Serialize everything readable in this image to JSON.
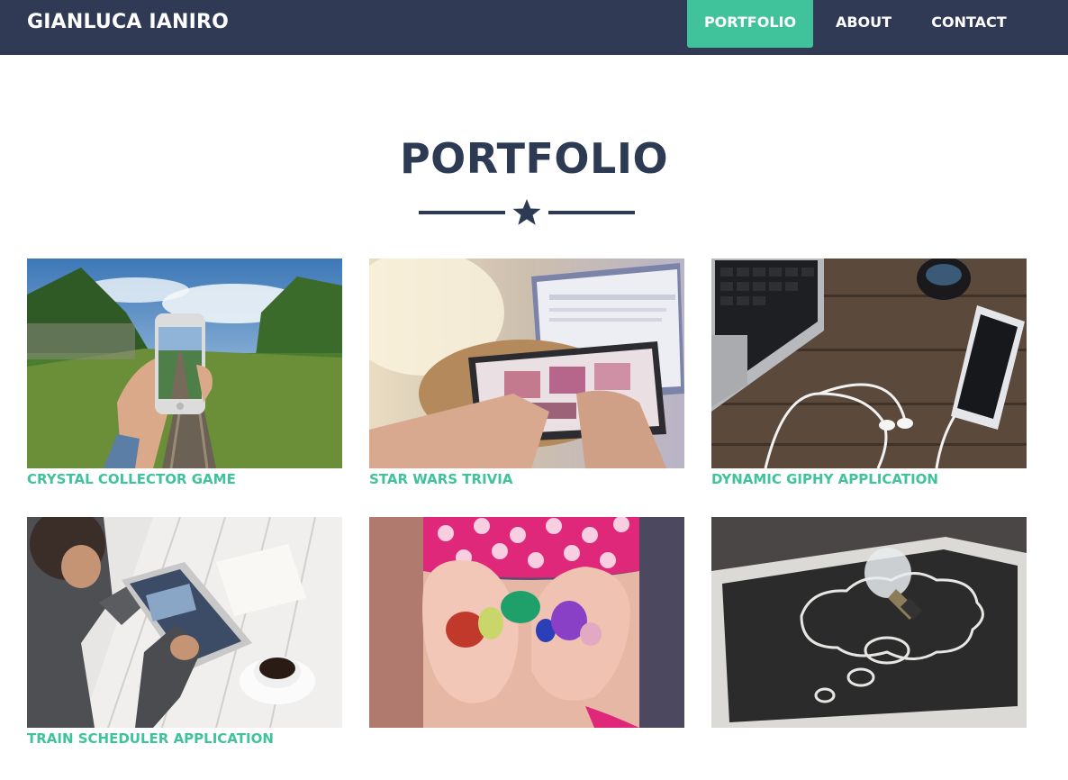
{
  "nav": {
    "brand": "GIANLUCA IANIRO",
    "items": [
      {
        "label": "PORTFOLIO",
        "active": true
      },
      {
        "label": "ABOUT",
        "active": false
      },
      {
        "label": "CONTACT",
        "active": false
      }
    ]
  },
  "portfolio": {
    "title": "PORTFOLIO",
    "divider_icon": "star-icon",
    "items": [
      {
        "caption": "CRYSTAL COLLECTOR GAME",
        "image": "hand-holding-phone-on-railway-photo"
      },
      {
        "caption": "STAR WARS TRIVIA",
        "image": "hands-using-tablet-photo"
      },
      {
        "caption": "DYNAMIC GIPHY APPLICATION",
        "image": "laptop-phone-earphones-on-wood-photo"
      },
      {
        "caption": "TRAIN SCHEDULER APPLICATION",
        "image": "man-using-tablet-with-coffee-photo"
      },
      {
        "caption": "",
        "image": "hands-holding-colored-stones-photo"
      },
      {
        "caption": "",
        "image": "lightbulb-on-chalkboard-photo"
      }
    ]
  },
  "colors": {
    "navbar_bg": "#313a55",
    "accent": "#40c29a",
    "heading": "#2d3a53",
    "page_bg": "#ffffff"
  }
}
